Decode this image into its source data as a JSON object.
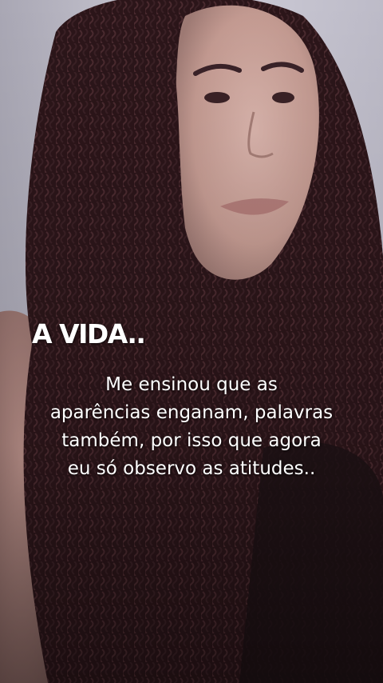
{
  "overlay": {
    "title": "A VIDA..",
    "caption_lines": [
      "Me ensinou que as",
      "aparências enganam, palavras",
      "também, por isso que agora",
      "eu só observo as atitudes.."
    ]
  },
  "colors": {
    "text": "#ffffff",
    "wall": "#c9c7d2",
    "hair": "#2a1518",
    "skin": "#c9a39a"
  }
}
